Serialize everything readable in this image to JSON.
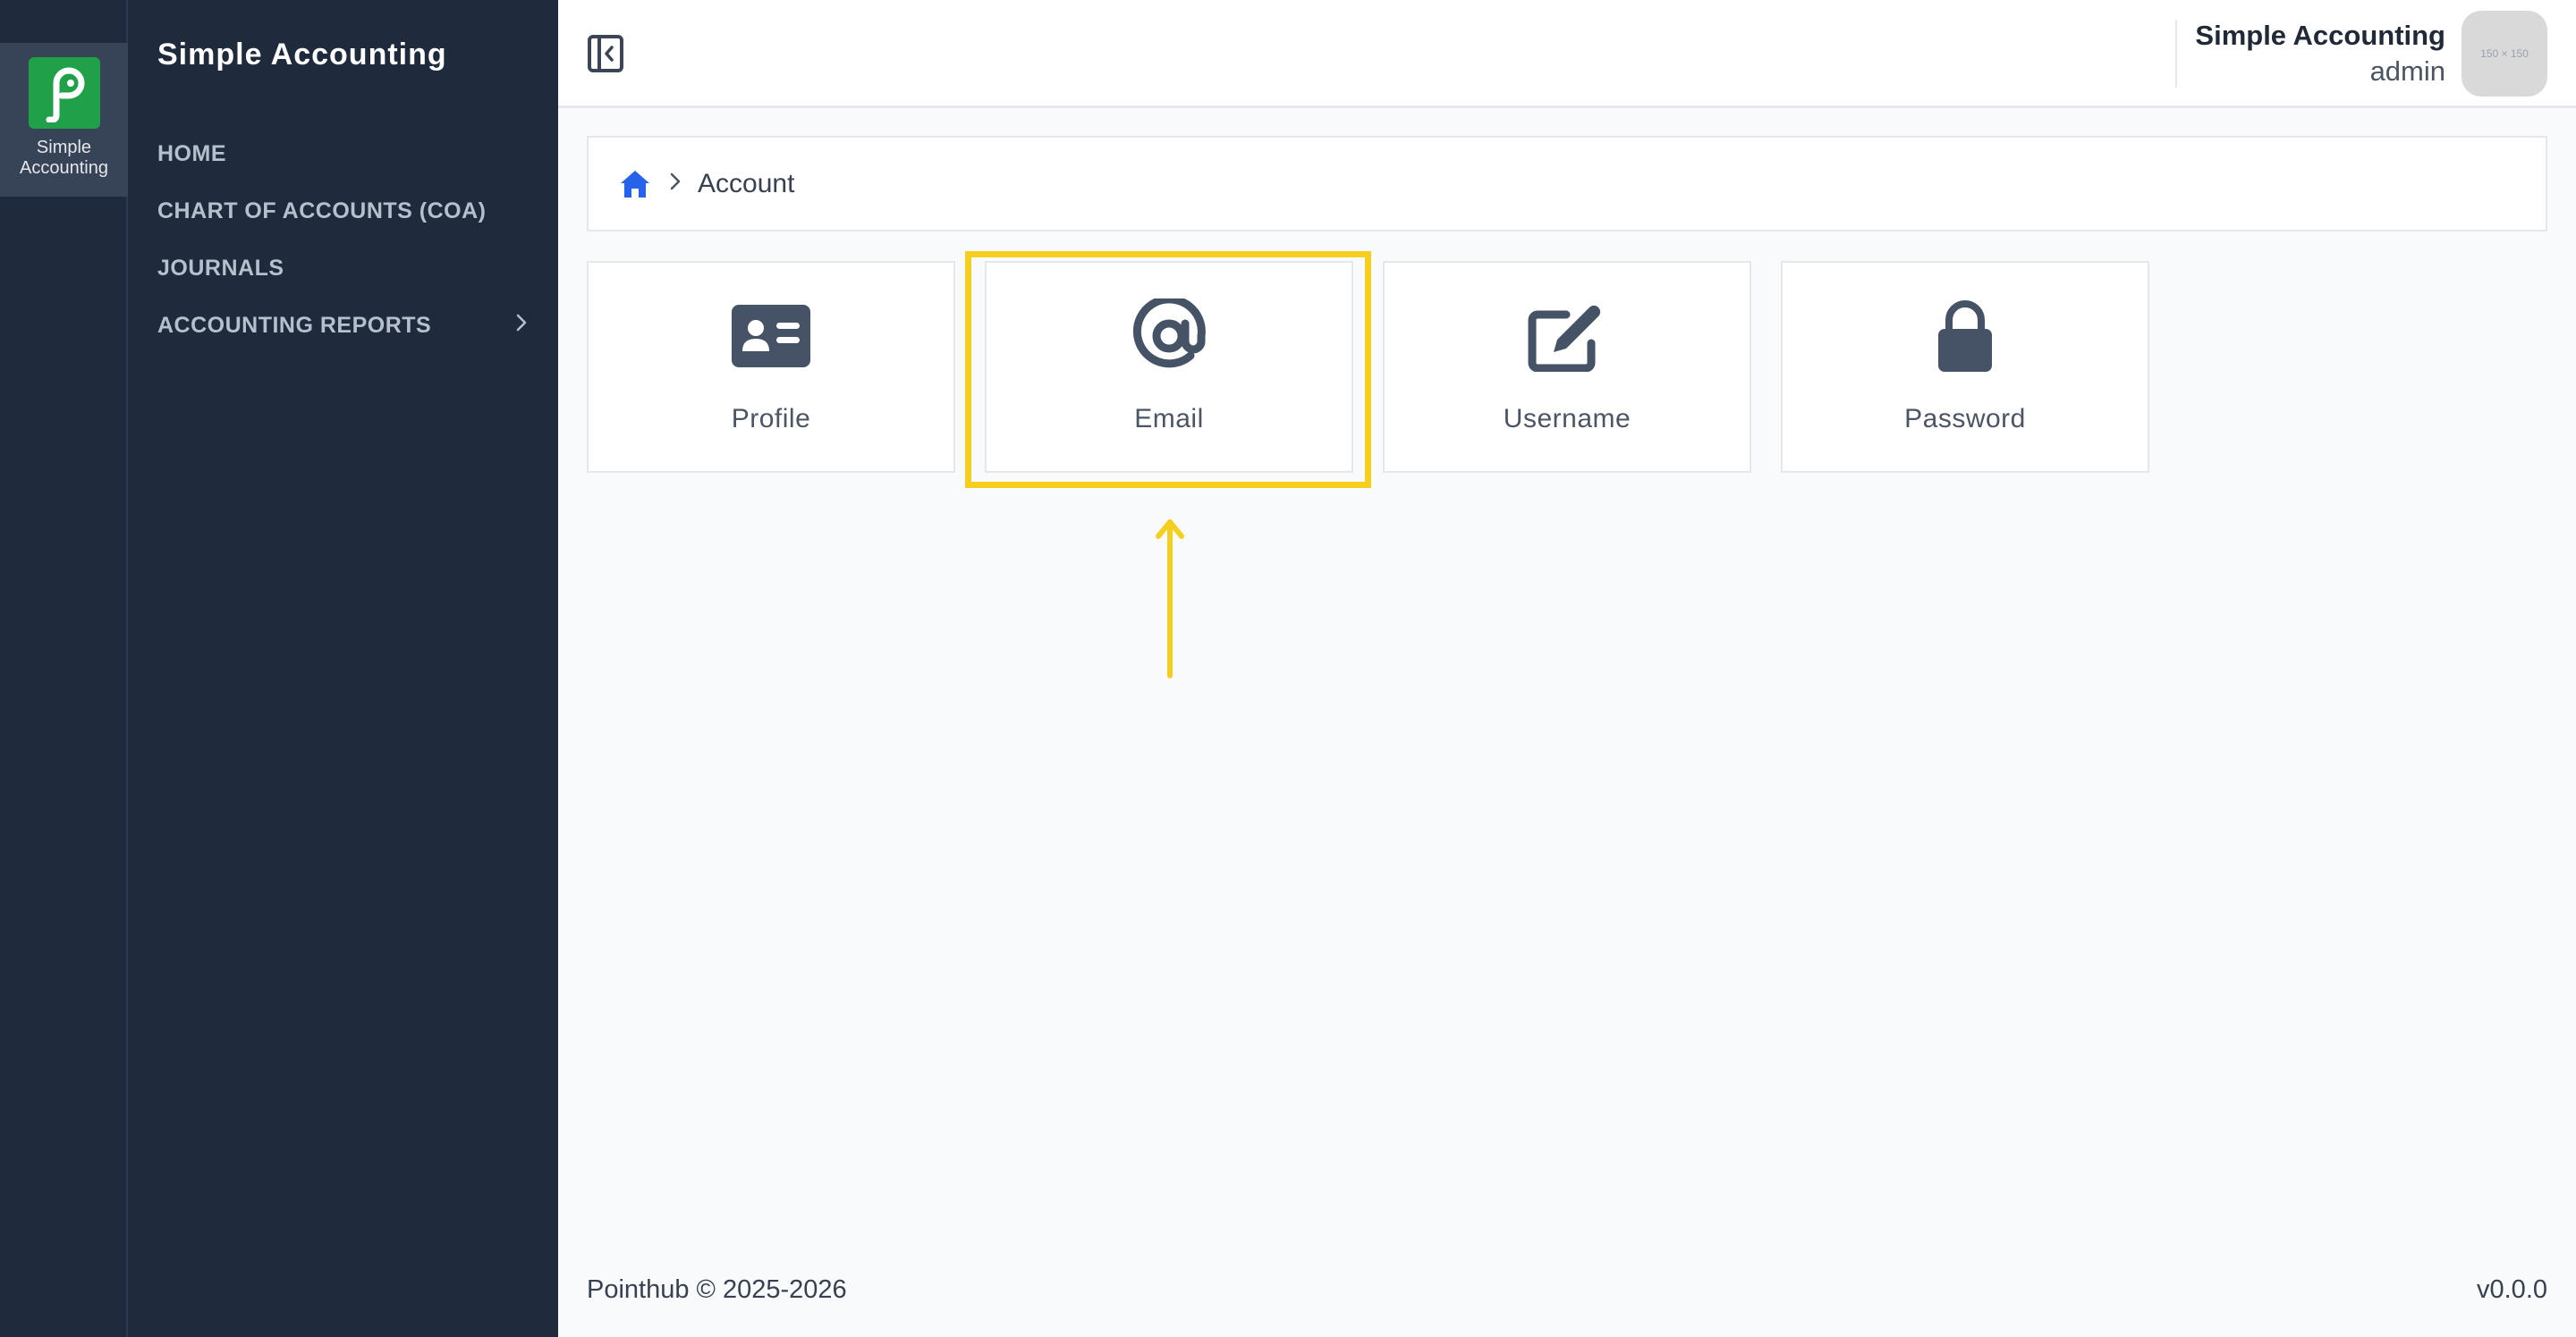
{
  "rail": {
    "app_label": "Simple Accounting"
  },
  "sidebar": {
    "title": "Simple Accounting",
    "items": [
      {
        "label": "HOME"
      },
      {
        "label": "CHART OF ACCOUNTS (COA)"
      },
      {
        "label": "JOURNALS"
      },
      {
        "label": "ACCOUNTING REPORTS"
      }
    ]
  },
  "header": {
    "app_name": "Simple Accounting",
    "user_role": "admin",
    "avatar_placeholder": "150 × 150"
  },
  "breadcrumb": {
    "current": "Account"
  },
  "tiles": [
    {
      "label": "Profile",
      "icon": "id-card-icon"
    },
    {
      "label": "Email",
      "icon": "at-sign-icon"
    },
    {
      "label": "Username",
      "icon": "edit-icon"
    },
    {
      "label": "Password",
      "icon": "lock-icon"
    }
  ],
  "footer": {
    "copyright": "Pointhub © 2025-2026",
    "version": "v0.0.0"
  },
  "colors": {
    "sidebar": "#1f2a3c",
    "logo": "#21a04a",
    "highlight": "#f6cf1e",
    "icon": "#465266",
    "home_icon": "#2563eb"
  }
}
